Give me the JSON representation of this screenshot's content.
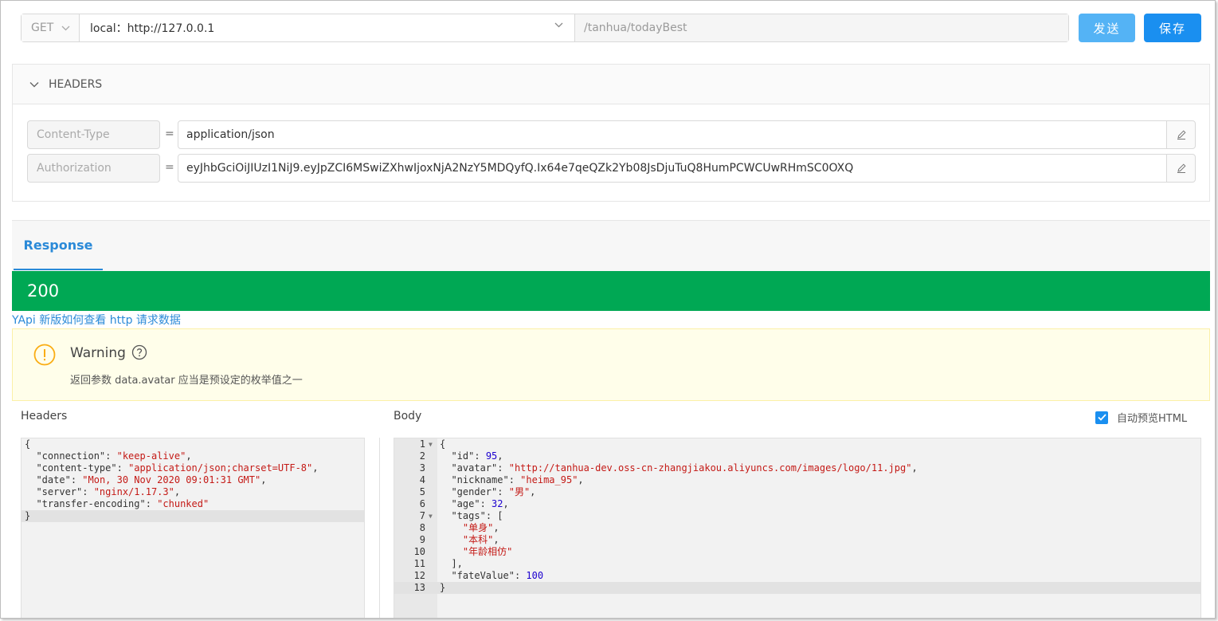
{
  "request": {
    "method": "GET",
    "env": "local：http://127.0.0.1",
    "path": "/tanhua/todayBest",
    "send_label": "发送",
    "save_label": "保存"
  },
  "headers_panel": {
    "title": "HEADERS",
    "rows": [
      {
        "name": "Content-Type",
        "value": "application/json"
      },
      {
        "name": "Authorization",
        "value": "eyJhbGciOiJIUzI1NiJ9.eyJpZCI6MSwiZXhwIjoxNjA2NzY5MDQyfQ.Ix64e7qeQZk2Yb08JsDjuTuQ8HumPCWCUwRHmSC0OXQ"
      }
    ]
  },
  "response": {
    "tab_label": "Response",
    "status_code": "200",
    "doc_link": "YApi 新版如何查看 http 请求数据",
    "warning_title": "Warning",
    "warning_message": "返回参数 data.avatar 应当是预设定的枚举值之一",
    "headers_label": "Headers",
    "body_label": "Body",
    "auto_preview_label": "自动预览HTML",
    "auto_preview_checked": true
  },
  "response_headers_lines": [
    "{",
    "  \"connection\": \"keep-alive\",",
    "  \"content-type\": \"application/json;charset=UTF-8\",",
    "  \"date\": \"Mon, 30 Nov 2020 09:01:31 GMT\",",
    "  \"server\": \"nginx/1.17.3\",",
    "  \"transfer-encoding\": \"chunked\"",
    "}"
  ],
  "response_body_lines": [
    "{",
    "  \"id\": 95,",
    "  \"avatar\": \"http://tanhua-dev.oss-cn-zhangjiakou.aliyuncs.com/images/logo/11.jpg\",",
    "  \"nickname\": \"heima_95\",",
    "  \"gender\": \"男\",",
    "  \"age\": 32,",
    "  \"tags\": [",
    "    \"单身\",",
    "    \"本科\",",
    "    \"年龄相仿\"",
    "  ],",
    "  \"fateValue\": 100",
    "}"
  ],
  "colors": {
    "send_button": "#54b3f5",
    "save_button": "#1a8ff0",
    "status_bar": "#00a854",
    "link": "#2b8ad8",
    "warning_bg": "#fffeea",
    "warning_icon": "#faad14"
  }
}
